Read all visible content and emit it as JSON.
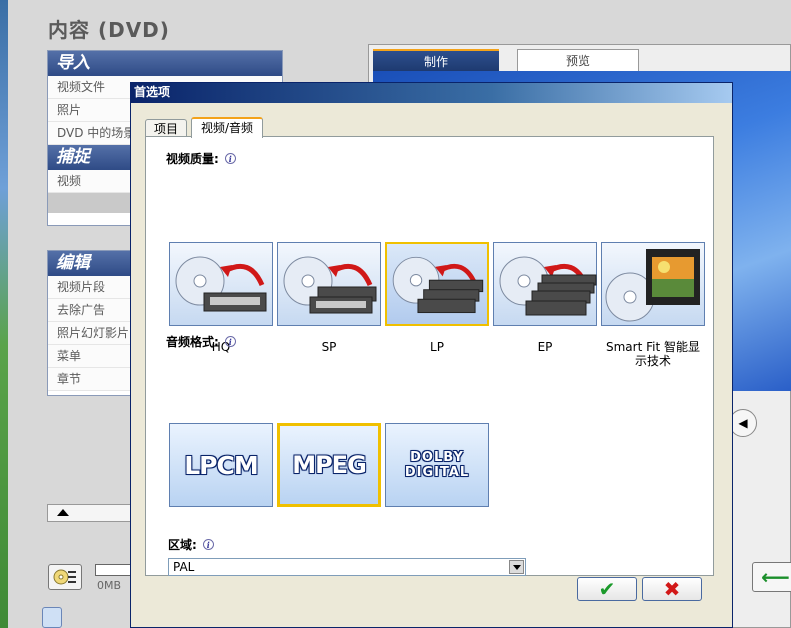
{
  "app": {
    "title": "内容 (DVD)",
    "import_panel": {
      "heading": "导入",
      "items": [
        "视频文件",
        "照片",
        "DVD 中的场景"
      ]
    },
    "capture_panel": {
      "heading": "捕捉",
      "items": [
        "视频"
      ]
    },
    "edit_panel": {
      "heading": "编辑",
      "items": [
        "视频片段",
        "去除广告",
        "照片幻灯影片",
        "菜单",
        "章节"
      ]
    },
    "meter_label": "0MB",
    "preview_tabs": {
      "make": "制作",
      "preview": "预览"
    }
  },
  "dialog": {
    "title": "首选项",
    "tabs": {
      "project": "项目",
      "video_audio": "视频/音频"
    },
    "video_quality": {
      "label": "视频质量:",
      "options": [
        "HQ",
        "SP",
        "LP",
        "EP",
        "Smart Fit 智能显示技术"
      ],
      "selected": "LP"
    },
    "audio_format": {
      "label": "音频格式:",
      "options": [
        "LPCM",
        "MPEG",
        "DOLBY DIGITAL"
      ],
      "selected": "MPEG"
    },
    "region": {
      "label": "区域:",
      "value": "PAL"
    },
    "ok_label": "✔",
    "cancel_label": "✖"
  },
  "colors": {
    "title_bar": "#0a246a",
    "selection_border": "#f0c000",
    "tab_accent": "#f3a21a",
    "ok_green": "#1b9a2b",
    "cancel_red": "#d21818"
  },
  "icons": {
    "quality": "disc-to-tape-icon",
    "smart_fit": "film-disc-icon",
    "info": "info-icon"
  }
}
